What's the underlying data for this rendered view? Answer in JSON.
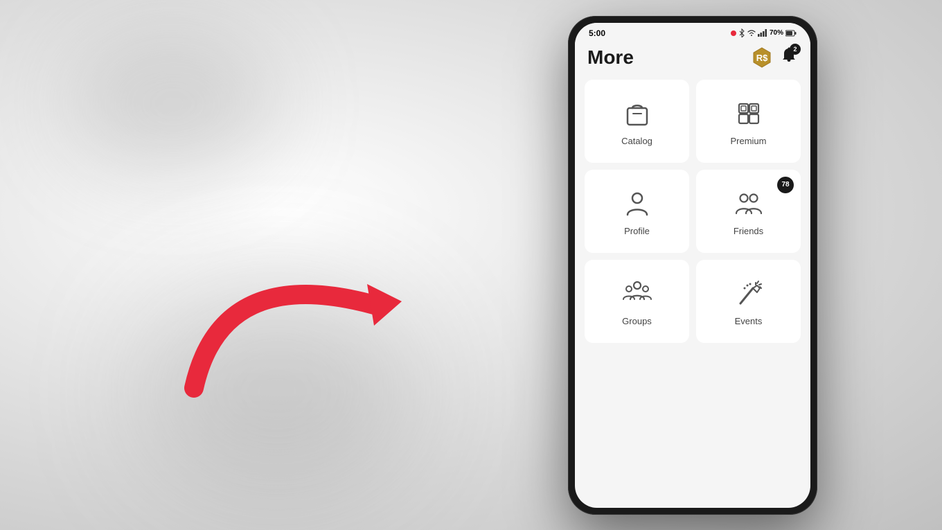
{
  "background": {
    "color": "#e0e0e0"
  },
  "status_bar": {
    "time": "5:00",
    "battery": "70%",
    "recording_dot": true
  },
  "app_header": {
    "title": "More",
    "notification_count": "2",
    "robux_label": "Robux"
  },
  "menu_items": [
    {
      "id": "catalog",
      "label": "Catalog",
      "icon": "shopping-bag-icon",
      "badge": null,
      "row": 0,
      "col": 0
    },
    {
      "id": "premium",
      "label": "Premium",
      "icon": "premium-icon",
      "badge": null,
      "row": 0,
      "col": 1
    },
    {
      "id": "profile",
      "label": "Profile",
      "icon": "person-icon",
      "badge": null,
      "row": 1,
      "col": 0
    },
    {
      "id": "friends",
      "label": "Friends",
      "icon": "friends-icon",
      "badge": "78",
      "row": 1,
      "col": 1
    },
    {
      "id": "groups",
      "label": "Groups",
      "icon": "groups-icon",
      "badge": null,
      "row": 2,
      "col": 0
    },
    {
      "id": "events",
      "label": "Events",
      "icon": "events-icon",
      "badge": null,
      "row": 2,
      "col": 1
    }
  ],
  "arrow": {
    "color": "#e8293c",
    "label": "Arrow pointing to Profile"
  }
}
